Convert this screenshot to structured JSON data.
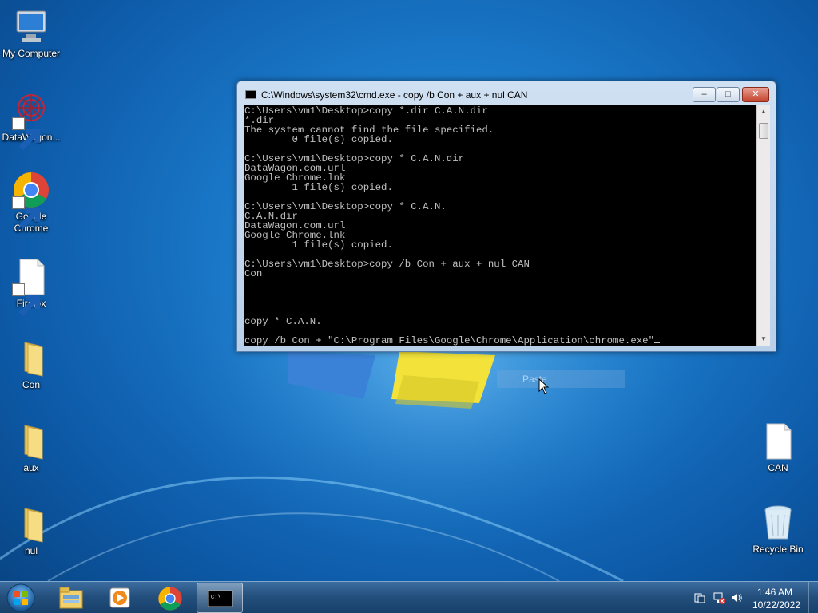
{
  "desktop": {
    "icons": [
      {
        "label": "My Computer",
        "icon": "computer-icon"
      },
      {
        "label": "DataWagon...",
        "icon": "datawagon-icon"
      },
      {
        "label": "Google Chrome",
        "icon": "chrome-icon"
      },
      {
        "label": "Firefox",
        "icon": "blank-file-icon"
      },
      {
        "label": "Con",
        "icon": "folder-icon"
      },
      {
        "label": "aux",
        "icon": "folder-icon"
      },
      {
        "label": "nul",
        "icon": "folder-icon"
      },
      {
        "label": "CAN",
        "icon": "blank-file-icon"
      },
      {
        "label": "Recycle Bin",
        "icon": "recycle-bin-icon"
      }
    ]
  },
  "cmd_window": {
    "title": "C:\\Windows\\system32\\cmd.exe - copy  /b Con + aux + nul CAN",
    "minimize_label": "–",
    "maximize_label": "□",
    "close_label": "✕",
    "console_text": "C:\\Users\\vm1\\Desktop>copy *.dir C.A.N.dir\n*.dir\nThe system cannot find the file specified.\n        0 file(s) copied.\n\nC:\\Users\\vm1\\Desktop>copy * C.A.N.dir\nDataWagon.com.url\nGoogle Chrome.lnk\n        1 file(s) copied.\n\nC:\\Users\\vm1\\Desktop>copy * C.A.N.\nC.A.N.dir\nDataWagon.com.url\nGoogle Chrome.lnk\n        1 file(s) copied.\n\nC:\\Users\\vm1\\Desktop>copy /b Con + aux + nul CAN\nCon\n\n\n\n\ncopy * C.A.N.\n\ncopy /b Con + \"C:\\Program Files\\Google\\Chrome\\Application\\chrome.exe\""
  },
  "context_hint": {
    "label": "Paste"
  },
  "taskbar": {
    "pinned": [
      "windows-explorer-icon",
      "media-player-icon",
      "chrome-icon",
      "cmd-icon"
    ],
    "active": "cmd-icon",
    "clock": {
      "time": "1:46 AM",
      "date": "10/22/2022"
    }
  },
  "colors": {
    "console_bg": "#000000",
    "console_fg": "#c0c0c0",
    "taskbar": "#24507e",
    "desktop": "#1a78c8"
  }
}
